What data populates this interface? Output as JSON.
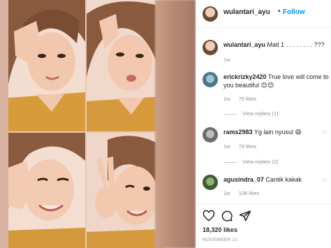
{
  "post": {
    "username": "wulantari_ayu",
    "dot": "•",
    "follow_label": "Follow",
    "caption": {
      "username": "wulantari_ayu",
      "text": "Mati 1 . . . . . . . . ???",
      "age": "1w"
    },
    "comments": [
      {
        "username": "erickrizky2420",
        "text": "True love will come to you beautiful 😊😊",
        "age": "1w",
        "likes": "75 likes",
        "replies": "View replies (1)"
      },
      {
        "username": "rams2983",
        "text": "Yg lain nyusul 😄",
        "age": "1w",
        "likes": "79 likes",
        "replies": "View replies (2)"
      },
      {
        "username": "agusindra_07",
        "text": "Cantik kakak",
        "age": "1w",
        "likes": "108 likes",
        "replies": ""
      }
    ],
    "likes_count": "18,320 likes",
    "date": "NOVEMBER 21"
  },
  "icons": {
    "like": "heart-icon",
    "comment": "comment-icon",
    "share": "share-icon",
    "comment_like": "small-heart-icon"
  },
  "colors": {
    "accent": "#0095f6",
    "text": "#262626",
    "muted": "#8e8e8e",
    "border": "#efefef"
  }
}
